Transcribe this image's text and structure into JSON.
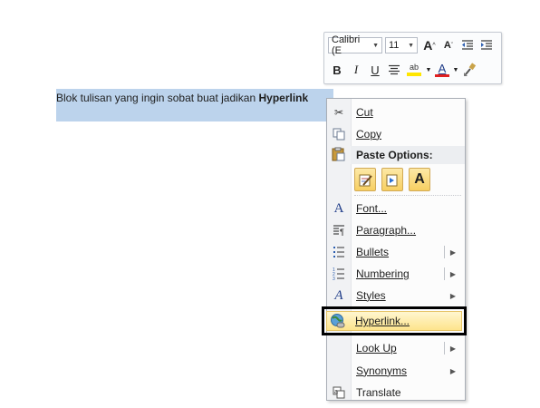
{
  "document": {
    "selected_text": "Blok tulisan yang ingin sobat buat jadikan ",
    "selected_bold": "Hyperlink"
  },
  "mini_toolbar": {
    "font_name": "Calibri (E",
    "font_size": "11",
    "grow_font": "A",
    "shrink_font": "A",
    "bold": "B",
    "italic": "I",
    "underline": "U",
    "highlight": "ab",
    "font_color": "A"
  },
  "context_menu": {
    "cut": "Cut",
    "copy": "Copy",
    "paste_options": "Paste Options:",
    "paste_keep_text": "A",
    "font": "Font...",
    "paragraph": "Paragraph...",
    "bullets": "Bullets",
    "numbering": "Numbering",
    "styles": "Styles",
    "hyperlink": "Hyperlink...",
    "look_up": "Look Up",
    "synonyms": "Synonyms",
    "translate": "Translate"
  },
  "colors": {
    "selection": "#bcd3ec",
    "highlight_row": "#fde48c",
    "callout_border": "#000000",
    "font_color_bar": "#e02020",
    "highlighter_bar": "#ffe600"
  }
}
